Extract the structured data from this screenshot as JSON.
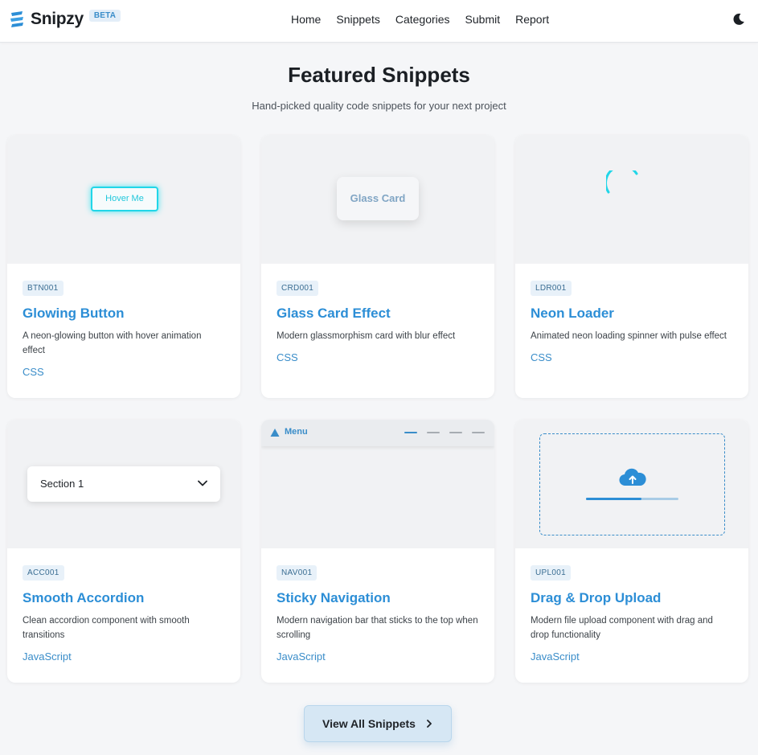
{
  "brand": {
    "name": "Snipzy",
    "badge": "BETA"
  },
  "nav": {
    "items": [
      "Home",
      "Snippets",
      "Categories",
      "Submit",
      "Report"
    ]
  },
  "header": {
    "title": "Featured Snippets",
    "subtitle": "Hand-picked quality code snippets for your next project"
  },
  "cards": [
    {
      "code": "BTN001",
      "title": "Glowing Button",
      "description": "A neon-glowing button with hover animation effect",
      "tag": "CSS",
      "preview_text": "Hover Me"
    },
    {
      "code": "CRD001",
      "title": "Glass Card Effect",
      "description": "Modern glassmorphism card with blur effect",
      "tag": "CSS",
      "preview_text": "Glass Card"
    },
    {
      "code": "LDR001",
      "title": "Neon Loader",
      "description": "Animated neon loading spinner with pulse effect",
      "tag": "CSS"
    },
    {
      "code": "ACC001",
      "title": "Smooth Accordion",
      "description": "Clean accordion component with smooth transitions",
      "tag": "JavaScript",
      "preview_text": "Section 1"
    },
    {
      "code": "NAV001",
      "title": "Sticky Navigation",
      "description": "Modern navigation bar that sticks to the top when scrolling",
      "tag": "JavaScript",
      "preview_text": "Menu"
    },
    {
      "code": "UPL001",
      "title": "Drag & Drop Upload",
      "description": "Modern file upload component with drag and drop functionality",
      "tag": "JavaScript",
      "upload_progress": 0.6
    }
  ],
  "view_all": {
    "label": "View All Snippets"
  },
  "colors": {
    "accent": "#2c8ed6",
    "neon": "#21d6e8",
    "background": "#f5f6f8"
  },
  "icons": {
    "theme": "moon-icon",
    "view_all": "chevron-right-icon",
    "accordion": "chevron-down-icon",
    "upload": "cloud-upload-icon"
  }
}
